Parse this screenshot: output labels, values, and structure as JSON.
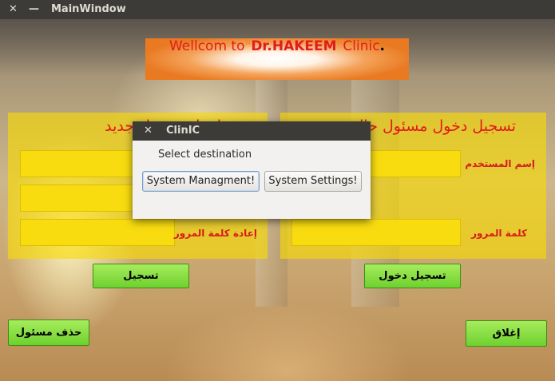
{
  "window": {
    "title": "MainWindow",
    "close_glyph": "✕",
    "minimize_glyph": "—"
  },
  "banner": {
    "part1": "Wellcom to",
    "quote_open": "\"",
    "name": "Dr.HAKEEM",
    "quote_close": "\"",
    "part2": "Clinic",
    "dot": "."
  },
  "register_panel": {
    "title": "إعداد مسئول جديد",
    "confirm_password_label": "إعادة كلمة المرور",
    "register_button": "تسجيل"
  },
  "login_panel": {
    "title": "تسجيل دخول مسئول حالي",
    "username_label": "إسم المستخدم",
    "password_label": "كلمة المرور",
    "login_button": "تسجيل دخول"
  },
  "bottom": {
    "delete_admin_button": "حذف مسئول",
    "close_button": "إغلاق"
  },
  "dialog": {
    "title": "ClinIC",
    "close_glyph": "✕",
    "message": "Select destination",
    "btn_management": "System Managment!",
    "btn_settings": "System Settings!"
  },
  "colors": {
    "panel": "#f8dc00",
    "label_red": "#e31a1a",
    "button_green": "#6ed12f"
  },
  "icons": [
    "close-icon",
    "minimize-icon"
  ]
}
